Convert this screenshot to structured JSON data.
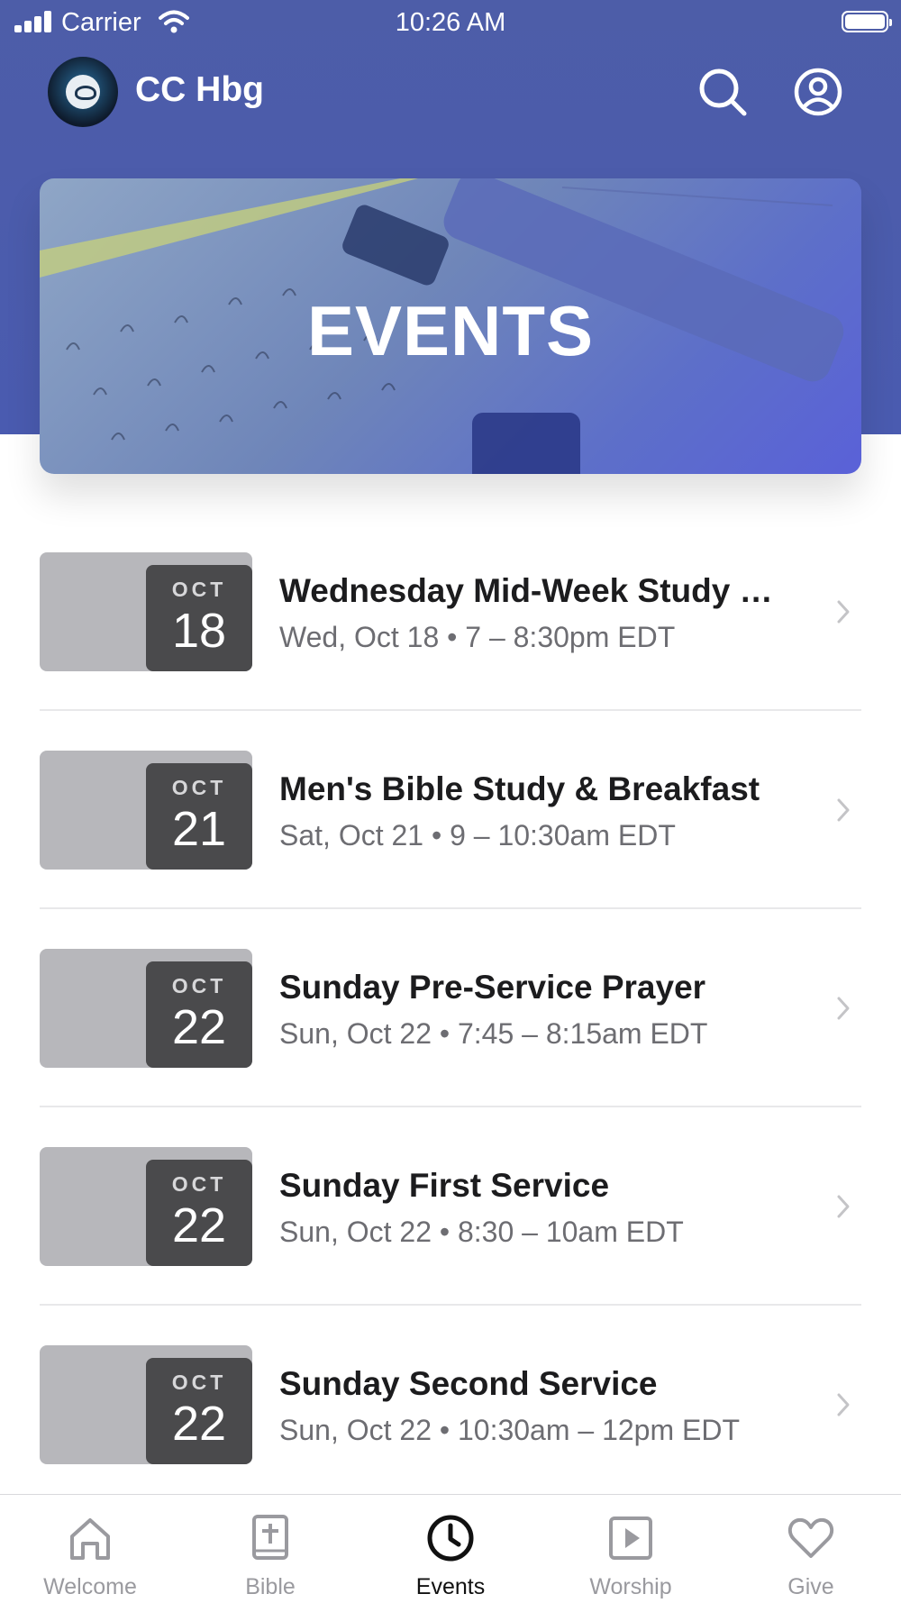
{
  "status_bar": {
    "carrier": "Carrier",
    "time": "10:26 AM"
  },
  "header": {
    "app_name": "CC Hbg"
  },
  "hero": {
    "title": "EVENTS"
  },
  "events": [
    {
      "month": "OCT",
      "day": "18",
      "title": "Wednesday Mid-Week Study &...",
      "subtitle": "Wed, Oct 18 • 7 – 8:30pm EDT"
    },
    {
      "month": "OCT",
      "day": "21",
      "title": "Men's Bible Study & Breakfast",
      "subtitle": "Sat, Oct 21 • 9 – 10:30am EDT"
    },
    {
      "month": "OCT",
      "day": "22",
      "title": "Sunday Pre-Service Prayer",
      "subtitle": "Sun, Oct 22 • 7:45 – 8:15am EDT"
    },
    {
      "month": "OCT",
      "day": "22",
      "title": "Sunday First Service",
      "subtitle": "Sun, Oct 22 • 8:30 – 10am EDT"
    },
    {
      "month": "OCT",
      "day": "22",
      "title": "Sunday Second Service",
      "subtitle": "Sun, Oct 22 • 10:30am – 12pm EDT"
    }
  ],
  "tabs": [
    {
      "label": "Welcome",
      "icon": "home-icon"
    },
    {
      "label": "Bible",
      "icon": "bible-icon"
    },
    {
      "label": "Events",
      "icon": "clock-icon",
      "active": true
    },
    {
      "label": "Worship",
      "icon": "play-icon"
    },
    {
      "label": "Give",
      "icon": "heart-icon"
    }
  ],
  "colors": {
    "header": "#4d5da8",
    "date_box": "#4a4a4c",
    "thumb": "#b7b7bb"
  }
}
